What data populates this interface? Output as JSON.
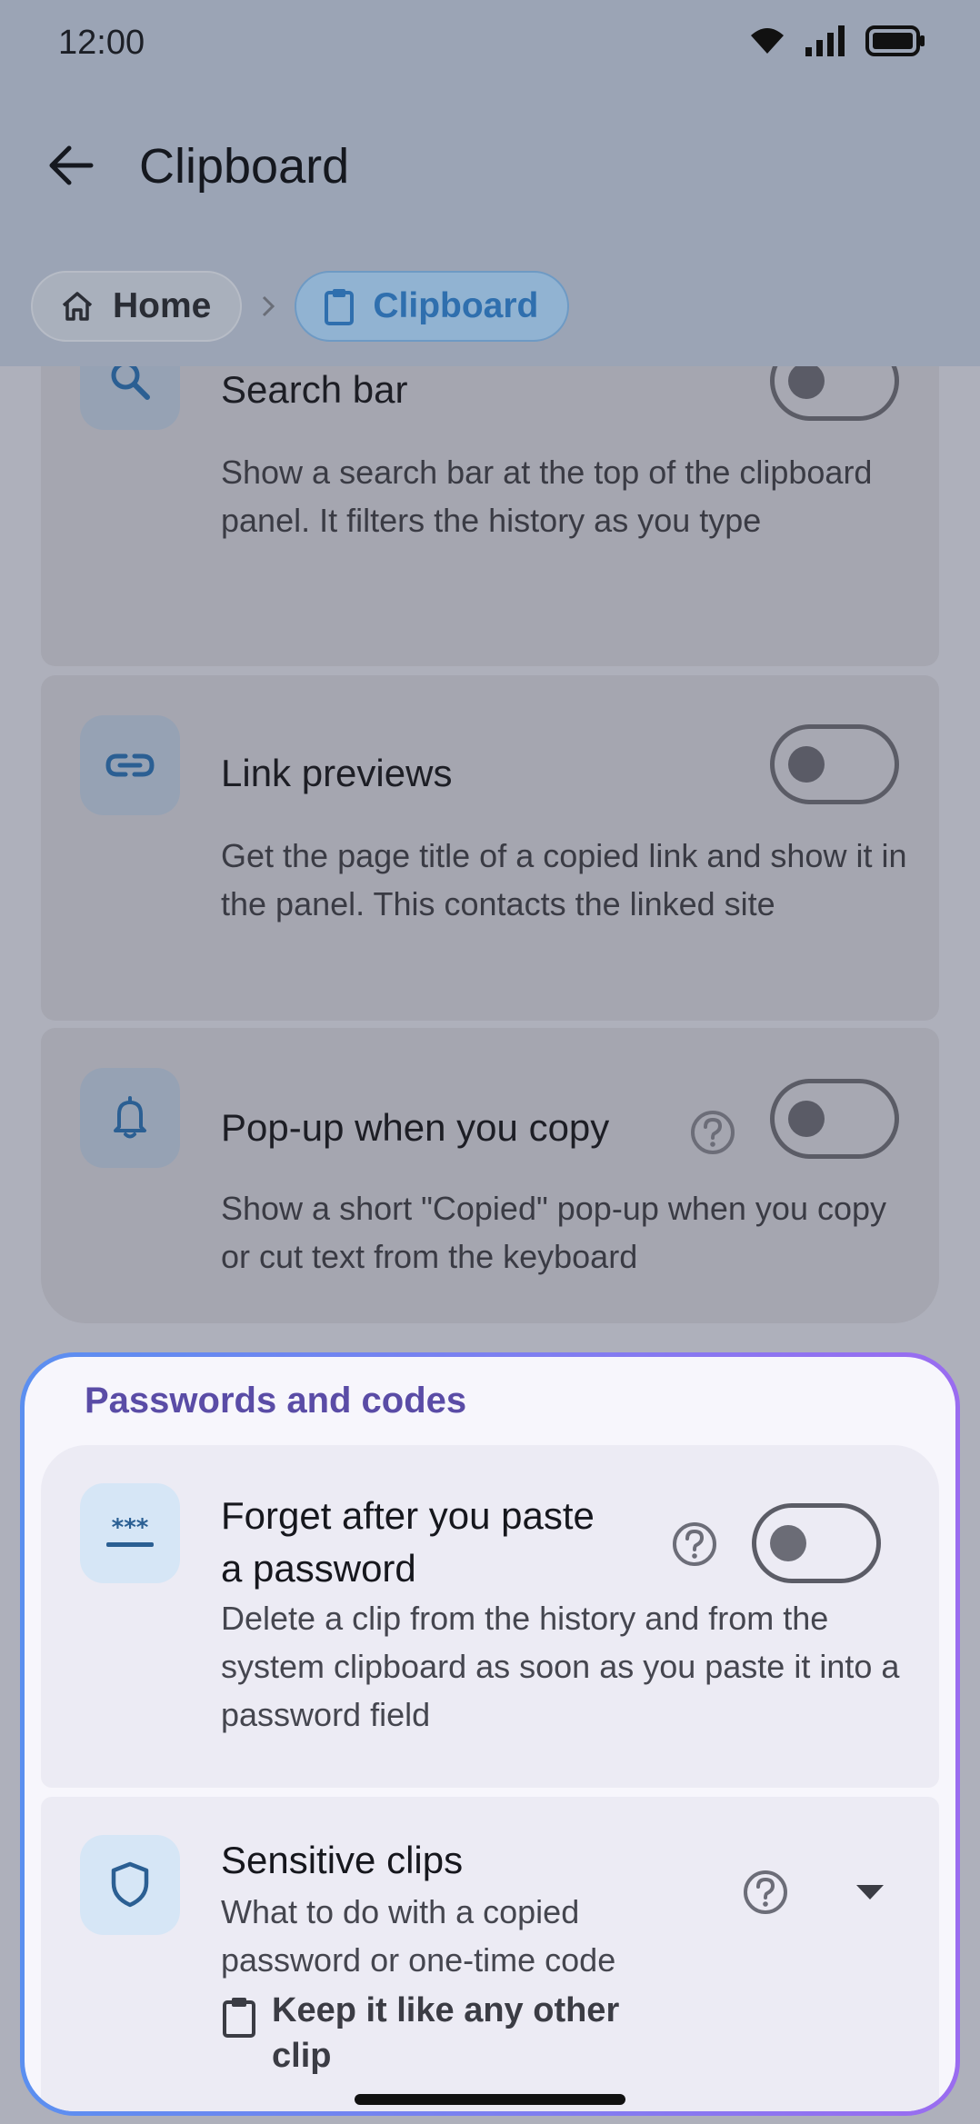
{
  "status_bar": {
    "time": "12:00"
  },
  "app_bar": {
    "title": "Clipboard"
  },
  "breadcrumb": [
    {
      "label": "Home",
      "icon": "home-icon"
    },
    {
      "label": "Clipboard",
      "icon": "clipboard-icon",
      "current": true
    }
  ],
  "settings": [
    {
      "icon": "search-icon",
      "title": "Search bar",
      "description": "Show a search bar at the top of the clipboard panel. It filters the history as you type",
      "toggle_on": false
    },
    {
      "icon": "link-icon",
      "title": "Link previews",
      "description": "Get the page title of a copied link and show it in the panel. This contacts the linked site",
      "toggle_on": false
    },
    {
      "icon": "bell-icon",
      "title": "Pop-up when you copy",
      "description": "Show a short \"Copied\" pop-up when you copy or cut text from the keyboard",
      "toggle_on": false,
      "has_help": true
    }
  ],
  "passwords_section": {
    "title": "Passwords and codes",
    "items": [
      {
        "icon": "password-icon",
        "title_line1": "Forget after you paste",
        "title_line2": "a password",
        "description": "Delete a clip from the history and from the system clipboard as soon as you paste it into a password field",
        "toggle_on": false,
        "has_help": true
      },
      {
        "icon": "shield-icon",
        "title": "Sensitive clips",
        "description": "What to do with a copied password or one-time code",
        "selected_value": "Keep it like any other clip",
        "value_icon": "clipboard-icon",
        "has_help": true
      }
    ]
  },
  "colors": {
    "accent": "#5a4ca6",
    "breadcrumb_current": "#2f6fae",
    "panel_gradient_start": "#5b8ff0",
    "panel_gradient_end": "#9a6cf0"
  }
}
